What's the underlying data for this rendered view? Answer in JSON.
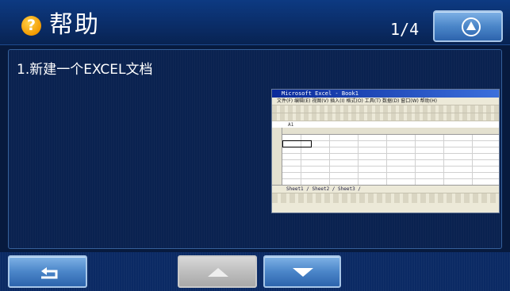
{
  "header": {
    "title": "帮助",
    "page_indicator": "1/4",
    "help_icon": "question-mark-icon",
    "home_icon": "navigation-arrow-icon"
  },
  "content": {
    "step_label": "1.新建一个EXCEL文档",
    "screenshot": {
      "window_title": "Microsoft Excel - Book1",
      "menu_items": "文件(F)  编辑(E)  视图(V)  插入(I)  格式(O)  工具(T)  数据(D)  窗口(W)  帮助(H)",
      "name_box": "A1",
      "sheet_tabs": "Sheet1 / Sheet2 / Sheet3 /"
    }
  },
  "footer": {
    "back_icon": "return-arrow-icon",
    "up_icon": "up-arrow-icon",
    "down_icon": "down-arrow-icon",
    "up_enabled": false,
    "down_enabled": true
  },
  "colors": {
    "background": "#071a3e",
    "header": "#0a2c66",
    "button_blue": "#4b86c9",
    "button_disabled": "#bcbcbc",
    "help_icon": "#f29a00"
  }
}
